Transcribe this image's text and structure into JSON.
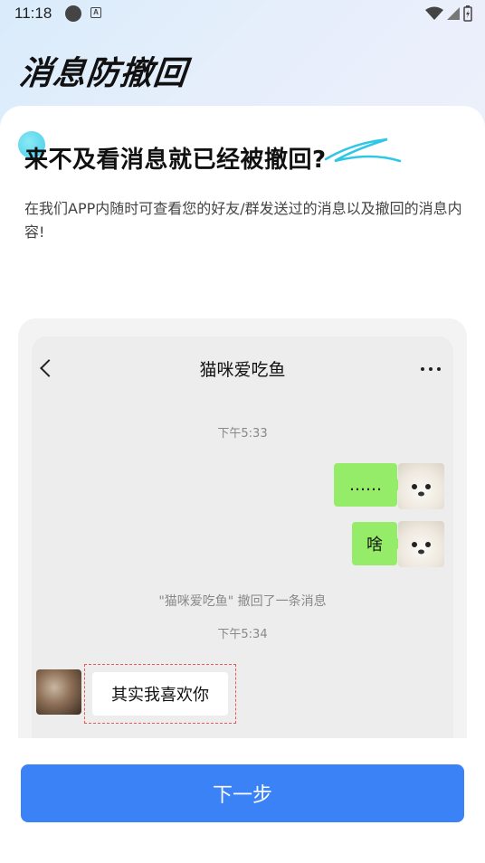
{
  "status_bar": {
    "time": "11:18",
    "icons": [
      "notification-dot-icon",
      "a-icon",
      "wifi-icon",
      "signal-icon",
      "battery-icon"
    ]
  },
  "page": {
    "title": "消息防撤回"
  },
  "intro": {
    "headline": "来不及看消息就已经被撤回?",
    "description": "在我们APP内随时可查看您的好友/群发送过的消息以及撤回的消息内容!"
  },
  "chat": {
    "title": "猫咪爱吃鱼",
    "timestamp1": "下午5:33",
    "message1": "……",
    "message2": "啥",
    "recall_notice": "\"猫咪爱吃鱼\" 撤回了一条消息",
    "timestamp2": "下午5:34",
    "recalled_message": "其实我喜欢你"
  },
  "actions": {
    "next_label": "下一步"
  },
  "colors": {
    "accent": "#3b82f6",
    "my_bubble": "#95ec69",
    "recall_border": "#e85a5a"
  }
}
